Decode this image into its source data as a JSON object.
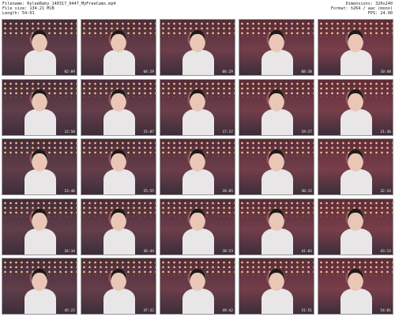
{
  "header": {
    "filename": "Filename: RyleeBaby_140317_0447_MyFreeCams.mp4",
    "filesize": "File size: 134.21 MiB",
    "length": "Length: 54:01",
    "dimensions": "Dimensions: 320x240",
    "format": "Format: h264 / aac (mono)",
    "fps": "FPS: 24.00"
  },
  "thumbnails": [
    {
      "time": "02:09"
    },
    {
      "time": "04:19"
    },
    {
      "time": "06:29"
    },
    {
      "time": "08:38"
    },
    {
      "time": "10:48"
    },
    {
      "time": "12:58"
    },
    {
      "time": "15:07"
    },
    {
      "time": "17:17"
    },
    {
      "time": "19:27"
    },
    {
      "time": "21:36"
    },
    {
      "time": "23:46"
    },
    {
      "time": "25:55"
    },
    {
      "time": "28:05"
    },
    {
      "time": "30:15"
    },
    {
      "time": "32:24"
    },
    {
      "time": "34:34"
    },
    {
      "time": "36:44"
    },
    {
      "time": "38:53"
    },
    {
      "time": "41:03"
    },
    {
      "time": "43:13"
    },
    {
      "time": "45:22"
    },
    {
      "time": "47:32"
    },
    {
      "time": "49:42"
    },
    {
      "time": "51:51"
    },
    {
      "time": "54:01"
    }
  ],
  "colors": {
    "lights": "#ffd29a",
    "wall": "#3a2a33"
  }
}
